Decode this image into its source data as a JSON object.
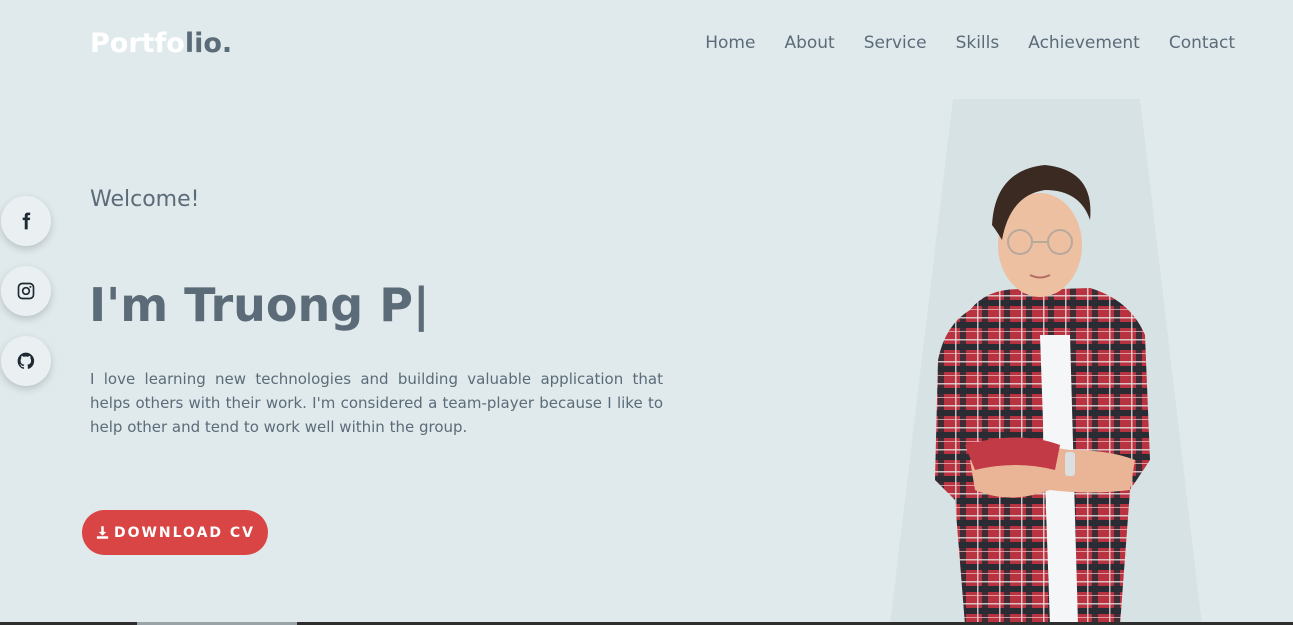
{
  "logo": {
    "part1": "Portfo",
    "part2": "lio."
  },
  "nav": {
    "items": [
      {
        "label": "Home"
      },
      {
        "label": "About"
      },
      {
        "label": "Service"
      },
      {
        "label": "Skills"
      },
      {
        "label": "Achievement"
      },
      {
        "label": "Contact"
      }
    ]
  },
  "social": {
    "items": [
      {
        "icon": "facebook-icon"
      },
      {
        "icon": "instagram-icon"
      },
      {
        "icon": "github-icon"
      }
    ]
  },
  "hero": {
    "welcome": "Welcome!",
    "name": "I'm Truong P|",
    "description": "I love learning new technologies and building valuable application that helps others with their work. I'm considered a team-player because I like to help other and tend to work well within the group.",
    "cta_label": "DOWNLOAD CV",
    "cta_icon": "download-icon"
  },
  "colors": {
    "background": "#e0eaed",
    "text": "#5b6b78",
    "accent": "#d94545",
    "logo_light": "#ffffff"
  }
}
